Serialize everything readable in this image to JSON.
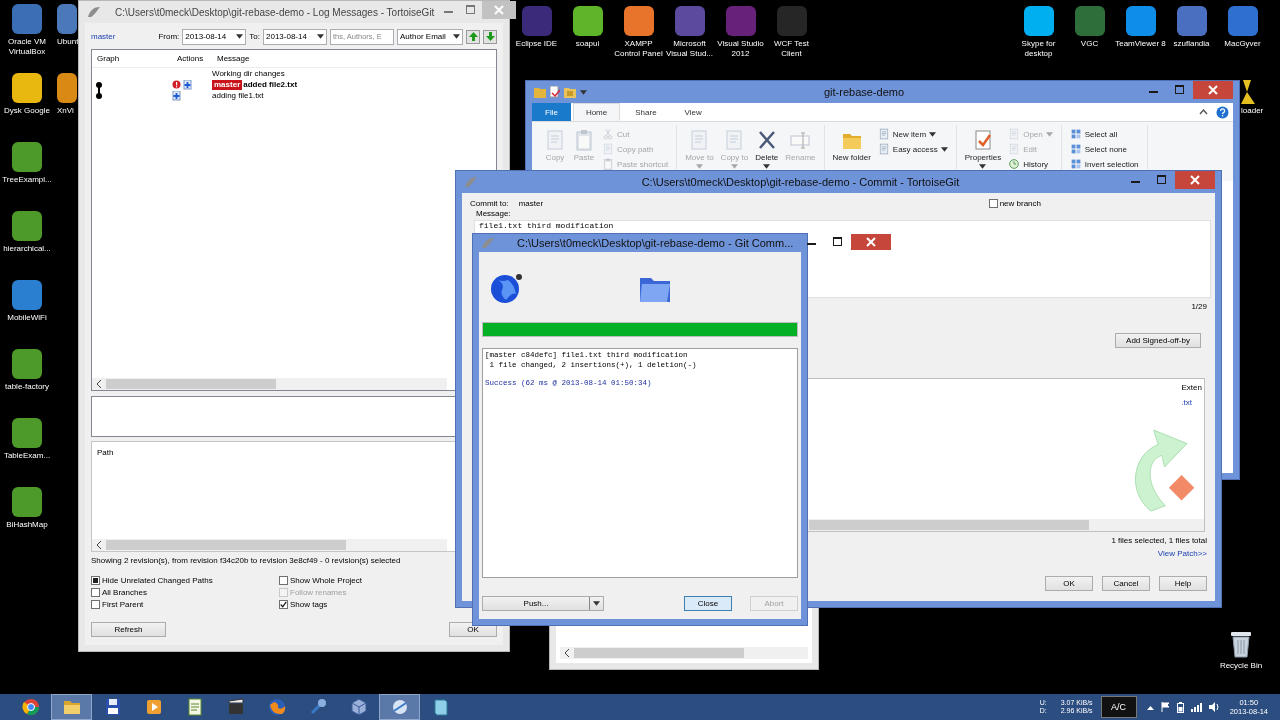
{
  "desktop": {
    "left_icons": [
      {
        "label": "Oracle VM VirtualBox",
        "color": "#3a6fb5"
      },
      {
        "label": "Dysk Google",
        "color": "#e8b810"
      },
      {
        "label": "TreeExampl...",
        "color": "#4d9a2a"
      },
      {
        "label": "hierarchical...",
        "color": "#4d9a2a"
      },
      {
        "label": "MobileWiFi",
        "color": "#2a7fd0"
      },
      {
        "label": "table-factory",
        "color": "#4d9a2a"
      },
      {
        "label": "TableExam...",
        "color": "#4d9a2a"
      },
      {
        "label": "BiHashMap",
        "color": "#4d9a2a"
      }
    ],
    "second_icons": [
      {
        "label": "Ubunt",
        "color": "#4a78b8"
      },
      {
        "label": "XnVi",
        "color": "#d88a14"
      }
    ],
    "top_icons": [
      {
        "label": "Eclipse IDE",
        "color": "#3b2a7a"
      },
      {
        "label": "soapui",
        "color": "#5fb52a"
      },
      {
        "label": "XAMPP Control Panel",
        "color": "#e8742b"
      },
      {
        "label": "Microsoft Visual Stud...",
        "color": "#5b4a9e"
      },
      {
        "label": "Visual Studio 2012",
        "color": "#68217a"
      },
      {
        "label": "WCF Test Client",
        "color": "#262626"
      }
    ],
    "right_icons": [
      {
        "label": "Skype for desktop",
        "color": "#00aff0"
      },
      {
        "label": "VGC",
        "color": "#2d6e3a"
      },
      {
        "label": "TeamViewer 8",
        "color": "#0e8ee9"
      },
      {
        "label": "szuflandia",
        "color": "#4a6fc0"
      },
      {
        "label": "MacGyver",
        "color": "#2f6fcf"
      }
    ],
    "edge_icon": {
      "label": "loader"
    },
    "recycle_bin": {
      "label": "Recycle Bin"
    }
  },
  "log_window": {
    "title": "C:\\Users\\t0meck\\Desktop\\git-rebase-demo - Log Messages - TortoiseGit",
    "active": false,
    "branch": "master",
    "from_label": "From:",
    "from_date": "2013-08-14",
    "to_label": "To:",
    "to_date": "2013-08-14",
    "search_placeholder": "ths, Authors, E",
    "filter": "Author Email",
    "columns": [
      "Graph",
      "Actions",
      "Message"
    ],
    "rows": [
      {
        "kind": "workdir",
        "message": "Working dir changes",
        "bold": false,
        "actions": []
      },
      {
        "kind": "commit",
        "tag": "master",
        "message": "added file2.txt",
        "bold": true,
        "actions": [
          {
            "kind": "alert"
          },
          {
            "kind": "add"
          }
        ]
      },
      {
        "kind": "commit",
        "message": "adding file1.txt",
        "bold": false,
        "actions": [
          {
            "kind": "add"
          }
        ]
      }
    ],
    "path_column": "Path",
    "status": "Showing 2 revision(s), from revision f34c20b to revision 3e8cf49 - 0 revision(s) selected",
    "options": [
      {
        "label": "Hide Unrelated Changed Paths",
        "kind": "square",
        "checked": true,
        "disabled": false
      },
      {
        "label": "All Branches",
        "kind": "tick",
        "checked": false,
        "disabled": false
      },
      {
        "label": "First Parent",
        "kind": "tick",
        "checked": false,
        "disabled": false
      },
      {
        "label": "Show Whole Project",
        "kind": "tick",
        "checked": false,
        "disabled": false
      },
      {
        "label": "Follow renames",
        "kind": "tick",
        "checked": false,
        "disabled": true
      },
      {
        "label": "Show tags",
        "kind": "tick",
        "checked": true,
        "disabled": false
      }
    ],
    "refresh_button": "Refresh",
    "ok_button": "OK"
  },
  "explorer_window": {
    "title": "git-rebase-demo",
    "active": true,
    "tabs": [
      {
        "label": "File",
        "kind": "file",
        "selected": false
      },
      {
        "label": "Home",
        "kind": "tab",
        "selected": true
      },
      {
        "label": "Share",
        "kind": "tab",
        "selected": false
      },
      {
        "label": "View",
        "kind": "tab",
        "selected": false
      }
    ],
    "ribbon": [
      {
        "large": [
          {
            "label": "Copy",
            "kind": "document",
            "disabled": true,
            "dropdown": false
          },
          {
            "label": "Paste",
            "kind": "clipboard",
            "disabled": true,
            "dropdown": false
          }
        ],
        "small": [
          {
            "label": "Cut",
            "kind": "scissors",
            "disabled": true,
            "dropdown": false
          },
          {
            "label": "Copy path",
            "kind": "document",
            "disabled": true,
            "dropdown": false
          },
          {
            "label": "Paste shortcut",
            "kind": "clipboard",
            "disabled": true,
            "dropdown": false
          }
        ]
      },
      {
        "large": [
          {
            "label": "Move to",
            "kind": "document",
            "disabled": true,
            "dropdown": true
          },
          {
            "label": "Copy to",
            "kind": "document",
            "disabled": true,
            "dropdown": true
          },
          {
            "label": "Delete",
            "kind": "cross",
            "disabled": false,
            "dropdown": true
          },
          {
            "label": "Rename",
            "kind": "rename",
            "disabled": true,
            "dropdown": false
          }
        ]
      },
      {
        "large": [
          {
            "label": "New folder",
            "kind": "folder",
            "disabled": false,
            "dropdown": false
          }
        ],
        "small": [
          {
            "label": "New item",
            "kind": "document",
            "disabled": false,
            "dropdown": true
          },
          {
            "label": "Easy access",
            "kind": "document",
            "disabled": false,
            "dropdown": true
          }
        ]
      },
      {
        "large": [
          {
            "label": "Properties",
            "kind": "check",
            "disabled": false,
            "dropdown": true
          }
        ],
        "small": [
          {
            "label": "Open",
            "kind": "document",
            "disabled": true,
            "dropdown": true
          },
          {
            "label": "Edit",
            "kind": "document",
            "disabled": true,
            "dropdown": false
          },
          {
            "label": "History",
            "kind": "clock",
            "disabled": false,
            "dropdown": false
          }
        ]
      },
      {
        "small": [
          {
            "label": "Select all",
            "kind": "grid",
            "disabled": false,
            "dropdown": false
          },
          {
            "label": "Select none",
            "kind": "grid",
            "disabled": false,
            "dropdown": false
          },
          {
            "label": "Invert selection",
            "kind": "grid",
            "disabled": false,
            "dropdown": false
          }
        ]
      }
    ]
  },
  "commit_window": {
    "title": "C:\\Users\\t0meck\\Desktop\\git-rebase-demo - Commit - TortoiseGit",
    "active": true,
    "commit_to_label": "Commit to:",
    "branch": "master",
    "new_branch": {
      "label": "new branch",
      "checked": false
    },
    "message_label": "Message:",
    "message": "file1.txt third modification",
    "counter": "1/29",
    "signoff_button": "Add Signed-off-by",
    "file_column": "Exten",
    "file_ext": ".txt",
    "summary": "1 files selected, 1 files total",
    "view_patch": "View Patch>>",
    "buttons": [
      "OK",
      "Cancel",
      "Help"
    ]
  },
  "progress_dialog": {
    "title": "C:\\Users\\t0meck\\Desktop\\git-rebase-demo - Git Comm...",
    "active": true,
    "progress": {
      "level": 1
    },
    "output": [
      {
        "kind": "normal",
        "text": "[master c84defc] file1.txt third modification"
      },
      {
        "kind": "normal",
        "text": " 1 file changed, 2 insertions(+), 1 deletion(-)"
      },
      {
        "kind": "success",
        "text": "Success (62 ms @ 2013-08-14 01:50:34)"
      }
    ],
    "push_button": "Push...",
    "close_button": {
      "label": "Close",
      "focused": true,
      "disabled": false
    },
    "abort_button": {
      "label": "Abort",
      "focused": false,
      "disabled": true
    }
  },
  "taskbar": {
    "apps": [
      {
        "kind": "chrome",
        "active": false
      },
      {
        "kind": "explorer",
        "active": true
      },
      {
        "kind": "floppy",
        "active": false
      },
      {
        "kind": "media",
        "active": false
      },
      {
        "kind": "notepad",
        "active": false
      },
      {
        "kind": "clapper",
        "active": false
      },
      {
        "kind": "firefox",
        "active": false
      },
      {
        "kind": "tools",
        "active": false
      },
      {
        "kind": "box",
        "active": false
      },
      {
        "kind": "tortoise",
        "active": true
      },
      {
        "kind": "book",
        "active": false
      }
    ],
    "up_label": "U:",
    "up_rate": "3.07 KiB/s",
    "down_label": "D:",
    "down_rate": "2.96 KiB/s",
    "power": "A/C",
    "time": "01:50",
    "date": "2013-08-14"
  }
}
